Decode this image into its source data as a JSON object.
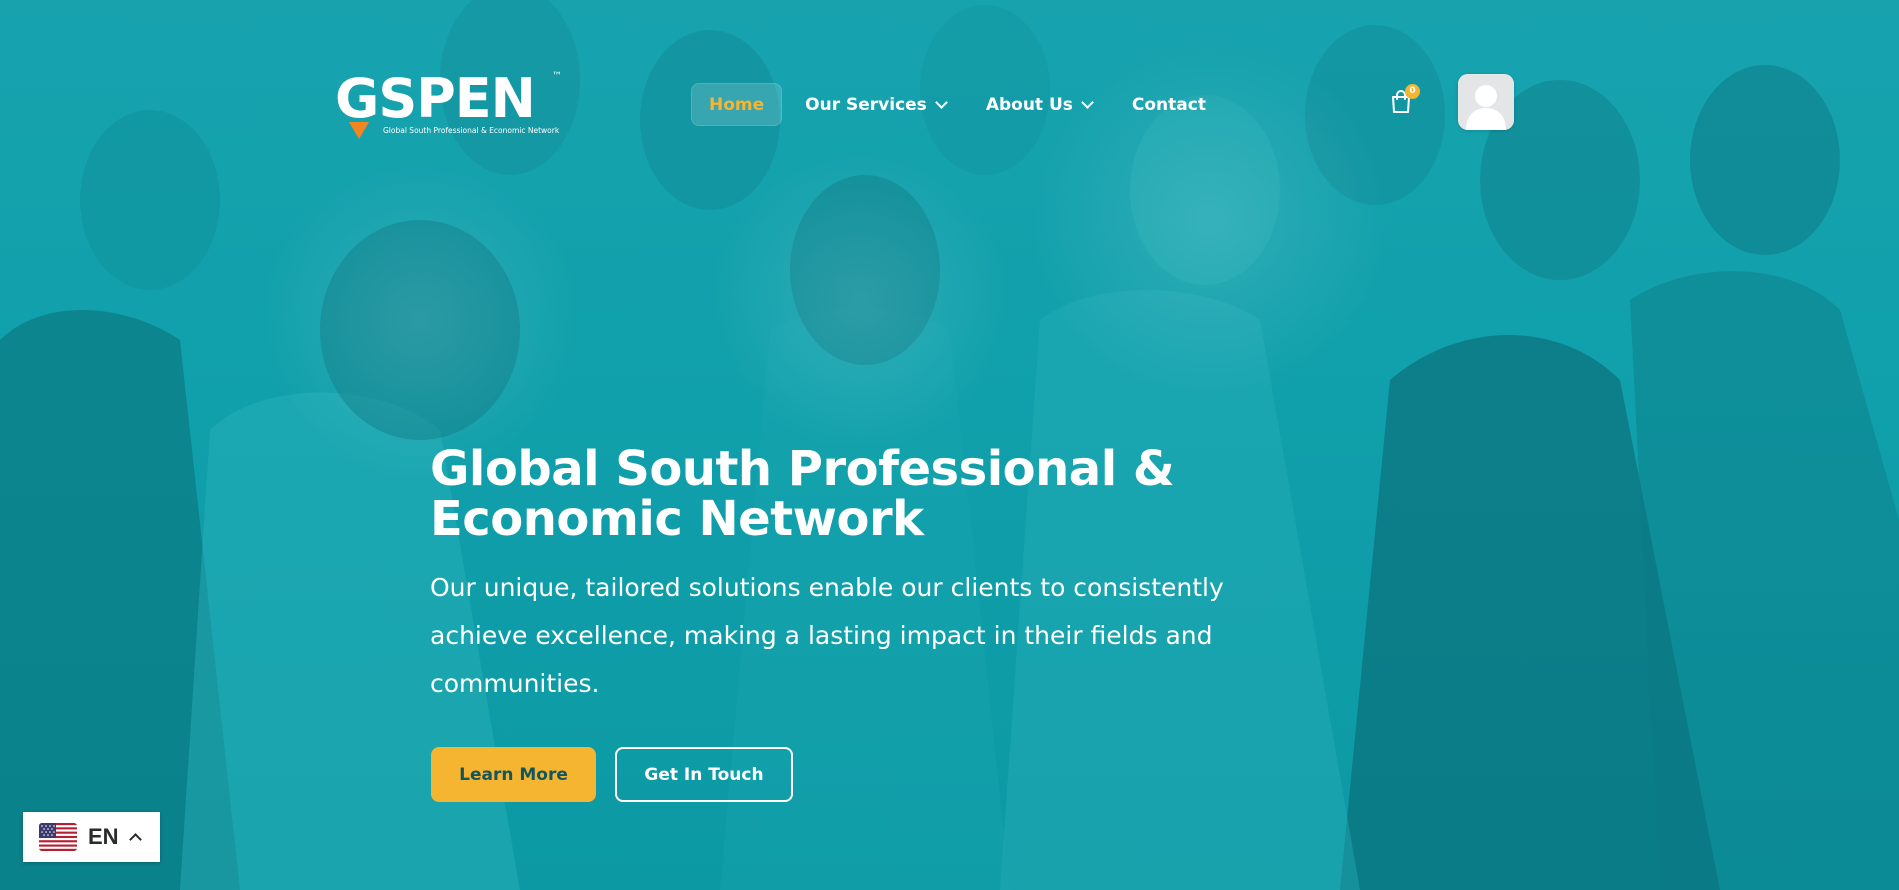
{
  "brand": {
    "name": "GSPEN",
    "trademark": "™",
    "tagline": "Global South Professional & Economic Network"
  },
  "nav": {
    "items": [
      {
        "label": "Home",
        "active": true,
        "has_dropdown": false
      },
      {
        "label": "Our Services",
        "active": false,
        "has_dropdown": true
      },
      {
        "label": "About Us",
        "active": false,
        "has_dropdown": true
      },
      {
        "label": "Contact",
        "active": false,
        "has_dropdown": false
      }
    ]
  },
  "cart": {
    "icon": "shopping-bag-icon",
    "count": "0"
  },
  "user": {
    "icon": "user-avatar-icon"
  },
  "hero": {
    "title": "Global South Professional & Economic Network",
    "subtitle": "Our unique, tailored solutions enable our clients to consistently achieve excellence, making a lasting impact in their fields and communities.",
    "primary_button": "Learn More",
    "secondary_button": "Get In Touch"
  },
  "language": {
    "code": "EN",
    "flag_icon": "us-flag-icon",
    "caret_icon": "chevron-up-icon"
  },
  "colors": {
    "overlay_teal": "#0b9aa6",
    "accent_yellow": "#f6b531",
    "logo_orange": "#f3861f",
    "white": "#ffffff"
  }
}
